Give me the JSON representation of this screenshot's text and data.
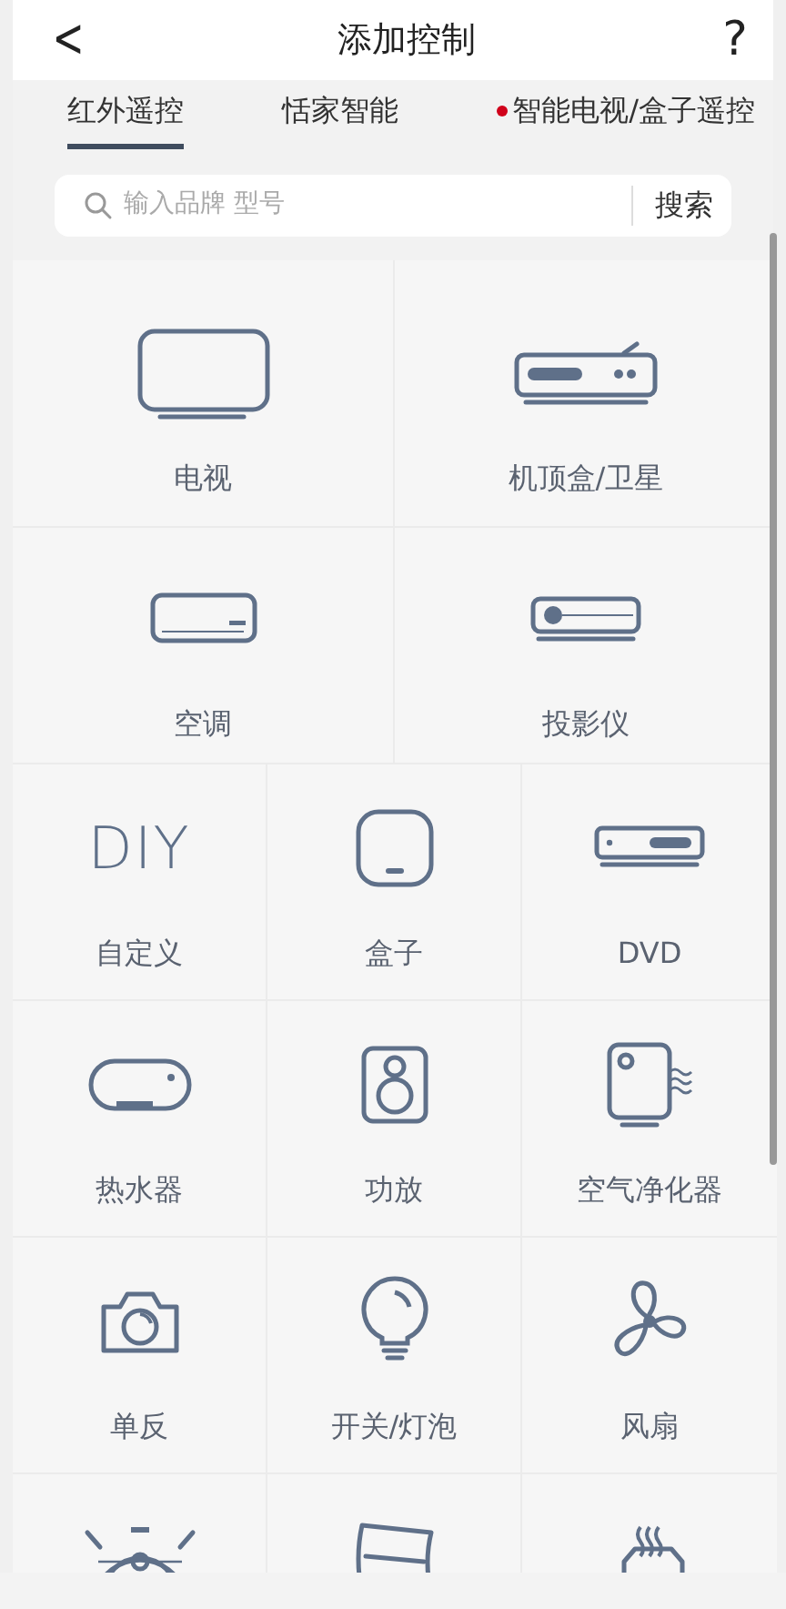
{
  "header": {
    "back": "<",
    "title": "添加控制",
    "help": "?"
  },
  "tabs": [
    {
      "label": "红外遥控",
      "selected": true,
      "dot": false
    },
    {
      "label": "恬家智能",
      "selected": false,
      "dot": false
    },
    {
      "label": "智能电视/盒子遥控",
      "selected": false,
      "dot": true
    }
  ],
  "search": {
    "placeholder": "输入品牌 型号",
    "button": "搜索"
  },
  "device_rows": [
    {
      "items": [
        {
          "kind": "tv",
          "label": "电视"
        },
        {
          "kind": "settop",
          "label": "机顶盒/卫星"
        }
      ]
    },
    {
      "items": [
        {
          "kind": "aircon",
          "label": "空调"
        },
        {
          "kind": "projector",
          "label": "投影仪"
        }
      ]
    },
    {
      "items": [
        {
          "kind": "diy",
          "icon_text": "DIY",
          "label": "自定义"
        },
        {
          "kind": "box",
          "label": "盒子"
        },
        {
          "kind": "dvd",
          "label": "DVD"
        }
      ]
    },
    {
      "items": [
        {
          "kind": "heater",
          "label": "热水器"
        },
        {
          "kind": "speaker",
          "label": "功放"
        },
        {
          "kind": "purifier",
          "label": "空气净化器"
        }
      ]
    },
    {
      "items": [
        {
          "kind": "camera",
          "label": "单反"
        },
        {
          "kind": "bulb",
          "label": "开关/灯泡"
        },
        {
          "kind": "fan",
          "label": "风扇"
        }
      ]
    },
    {
      "items": [
        {
          "kind": "robot"
        },
        {
          "kind": "radiator"
        },
        {
          "kind": "humidifier"
        }
      ]
    }
  ]
}
